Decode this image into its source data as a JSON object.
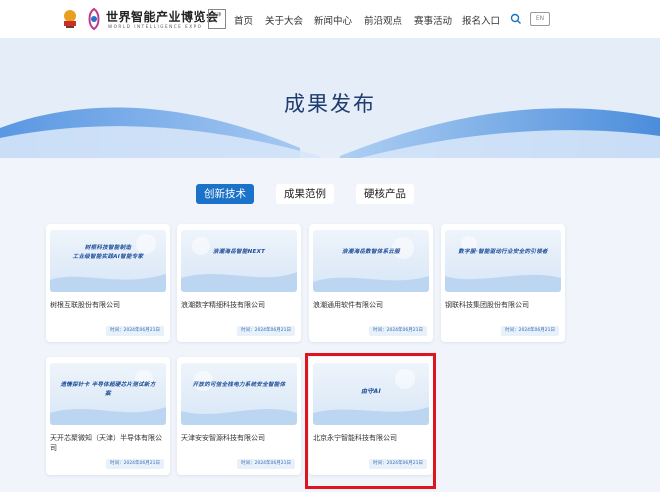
{
  "header": {
    "logo_title": "世界智能产业博览会",
    "logo_subtitle": "WORLD INTELLIGENCE EXPO",
    "logo_badge": "天津",
    "nav": [
      "首页",
      "关于大会",
      "新闻中心",
      "前沿观点",
      "赛事活动",
      "报名入口"
    ],
    "search_icon": "search-icon",
    "lang_label": "EN"
  },
  "banner": {
    "title": "成果发布"
  },
  "tabs": [
    {
      "label": "创新技术",
      "active": true
    },
    {
      "label": "成果范例",
      "active": false
    },
    {
      "label": "硬核产品",
      "active": false
    }
  ],
  "cards": [
    {
      "image_text": "树根科技智能制造\n工业级智能实践AI智能专家",
      "company": "树根互联股份有限公司",
      "date": "时间：2024年06月21日"
    },
    {
      "image_text": "浪潮海岳智能NEXT",
      "company": "浪潮数字精细科技有限公司",
      "date": "时间：2024年06月21日"
    },
    {
      "image_text": "浪潮海岳数智体系云服",
      "company": "浪潮通用软件有限公司",
      "date": "时间：2024年06月21日"
    },
    {
      "image_text": "数字服·智能驱动行业安全的引领者",
      "company": "钢联科技集团股份有限公司",
      "date": "时间：2024年06月21日"
    },
    {
      "image_text": "遗情探针卡  半导体超硬芯片测试新方案",
      "company": "天开芯聚微知（天津）半导体有限公司",
      "date": "时间：2024年06月21日"
    },
    {
      "image_text": "开放的可信全栈电力系统安全智能体",
      "company": "天津安安智源科技有限公司",
      "date": "时间：2024年06月21日"
    },
    {
      "image_text": "由守AI",
      "company": "北京永宁智能科技有限公司",
      "date": "时间：2024年06月21日"
    }
  ],
  "colors": {
    "accent": "#1a73c8",
    "highlight": "#e0141e",
    "banner_title": "#1e3c6e"
  }
}
